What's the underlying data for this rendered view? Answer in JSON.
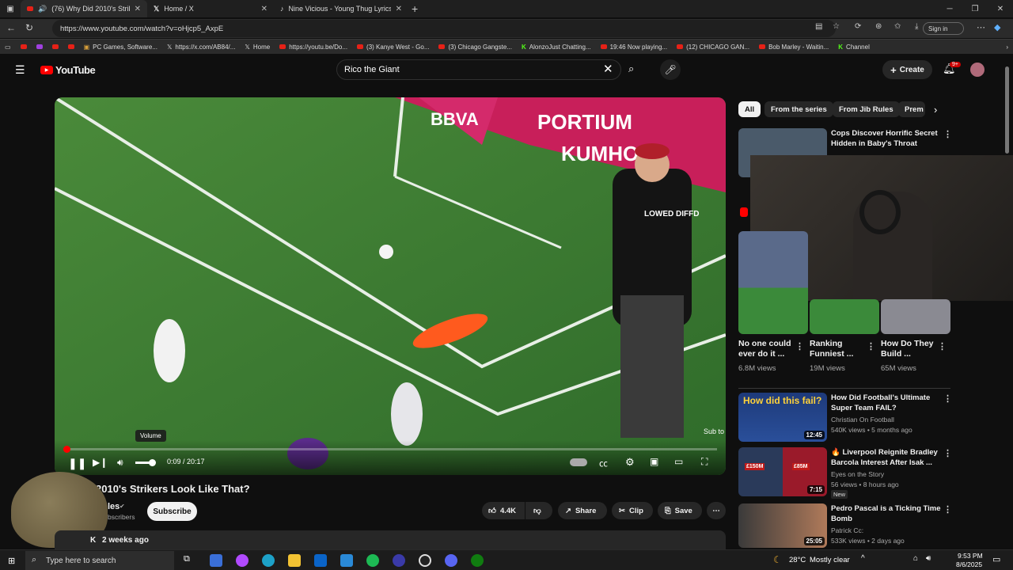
{
  "browser": {
    "tabs": [
      {
        "title": "(76) Why Did 2010's Strikers",
        "icon": "youtube-icon"
      },
      {
        "title": "Home / X",
        "icon": "x-icon"
      },
      {
        "title": "Nine Vicious - Young Thug Lyrics",
        "icon": "tiktok-icon"
      }
    ],
    "url": "https://www.youtube.com/watch?v=oHjcp5_AxpE",
    "sign_in": "Sign in",
    "bookmarks": [
      "PC Games, Software...",
      "https://x.com/AB84/...",
      "Home",
      "https://youtu.be/Do...",
      "(3) Kanye West - Go...",
      "(3) Chicago Gangste...",
      "AlonzoJust Chatting...",
      "19:46 Now playing...",
      "(12) CHICAGO GAN...",
      "Bob Marley - Waitin...",
      "Channel"
    ]
  },
  "youtube": {
    "logo_text": "YouTube",
    "search_value": "Rico the Giant",
    "create_label": "Create",
    "notif_badge": "9+"
  },
  "player": {
    "time": "0:09 / 20:17",
    "progress": 0.0074,
    "volume_tooltip": "Volume",
    "watermark": "Sub to Jib",
    "shirt_text": "LOWED DIFFD"
  },
  "video": {
    "title_partial": "2010's Strikers Look Like That?",
    "channel_partial": "les",
    "subs_partial": "bscribers",
    "subscribe_label": "Subscribe",
    "likes": "4.4K",
    "share_label": "Share",
    "clip_label": "Clip",
    "save_label": "Save",
    "age": "2 weeks ago",
    "views_partial": "K"
  },
  "chips": [
    "All",
    "From the series",
    "From Jib Rules",
    "Prem"
  ],
  "recs_top": {
    "title": "Cops Discover Horrific Secret Hidden in Baby's Throat"
  },
  "shorts": [
    {
      "title": "No one could ever do it ...",
      "views": "6.8M views"
    },
    {
      "title": "Ranking Funniest ...",
      "views": "19M views"
    },
    {
      "title": "How Do They Build ...",
      "views": "65M views"
    }
  ],
  "recs": [
    {
      "title": "How Did Football's Ultimate Super Team FAIL?",
      "channel": "Christian On Football",
      "meta": "540K views • 5 months ago",
      "duration": "12:45",
      "thumb_text": "How did this fail?"
    },
    {
      "title": "🔥 Liverpool Reignite Bradley Barcola Interest After Isak ...",
      "channel": "Eyes on the Story",
      "meta": "56 views • 8 hours ago",
      "duration": "7:15",
      "badge": "New",
      "thumb_text1": "£150M",
      "thumb_text2": "£85M"
    },
    {
      "title": "Pedro Pascal is a Ticking Time Bomb",
      "channel": "Patrick Cc:",
      "meta": "533K views • 2 days ago",
      "duration": "25:05"
    }
  ],
  "taskbar": {
    "search_placeholder": "Type here to search",
    "weather": "28°C",
    "weather_desc": "Mostly clear",
    "time": "9:53 PM",
    "date": "8/6/2025"
  }
}
